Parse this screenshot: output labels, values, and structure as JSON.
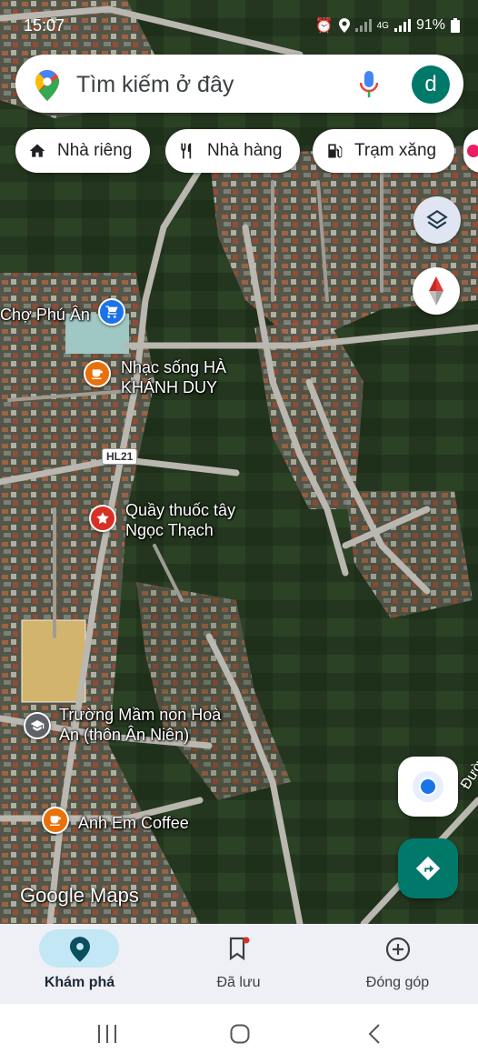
{
  "status_bar": {
    "time": "15:07",
    "network": "4G",
    "battery": "91%"
  },
  "search": {
    "placeholder": "Tìm kiếm ở đây",
    "avatar_initial": "d"
  },
  "chips": [
    {
      "label": "Nhà riêng",
      "icon": "home-icon"
    },
    {
      "label": "Nhà hàng",
      "icon": "restaurant-icon"
    },
    {
      "label": "Trạm xăng",
      "icon": "gas-station-icon"
    }
  ],
  "map": {
    "pois": [
      {
        "label": "Chợ Phú Ân",
        "icon": "shopping-cart-icon",
        "color": "#1a73e8"
      },
      {
        "label_line1": "Nhạc sống HÀ",
        "label_line2": "KHÁNH DUY",
        "icon": "coffee-icon",
        "color": "#e8710a"
      },
      {
        "label_line1": "Quầy thuốc tây",
        "label_line2": "Ngọc Thạch",
        "icon": "pharmacy-icon",
        "color": "#d93025"
      },
      {
        "label_line1": "Trường Mầm non Hoà",
        "label_line2": "An (thôn Ân Niên)",
        "icon": "school-icon",
        "color": "#5f6368"
      },
      {
        "label": "Anh Em Coffee",
        "icon": "coffee-icon",
        "color": "#e8710a"
      }
    ],
    "road_shield": "HL21",
    "edge_label": "Đườ",
    "watermark": "Google Maps"
  },
  "bottom_nav": [
    {
      "label": "Khám phá",
      "icon": "location-pin-icon",
      "active": true
    },
    {
      "label": "Đã lưu",
      "icon": "bookmark-icon",
      "active": false
    },
    {
      "label": "Đóng góp",
      "icon": "add-circle-icon",
      "active": false
    }
  ],
  "colors": {
    "accent": "#00796b",
    "directions_fab": "#00796b",
    "nav_active_pill": "#c3e7f4"
  }
}
